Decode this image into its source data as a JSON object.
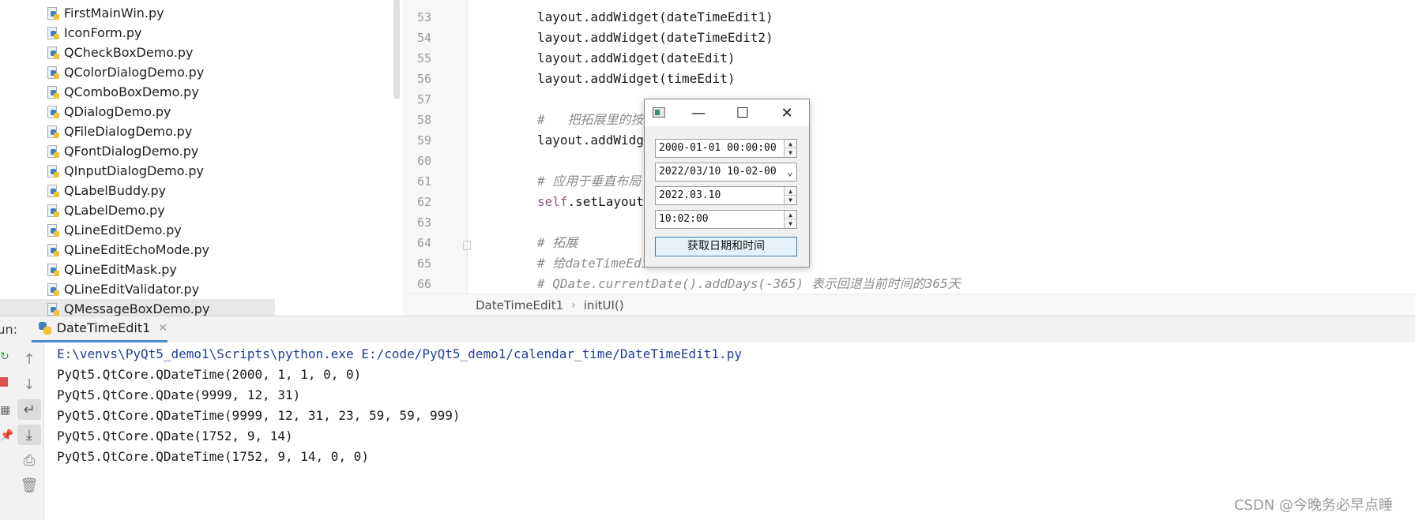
{
  "project_tree": {
    "items": [
      {
        "label": "FirstMainWin.py"
      },
      {
        "label": "IconForm.py"
      },
      {
        "label": "QCheckBoxDemo.py"
      },
      {
        "label": "QColorDialogDemo.py"
      },
      {
        "label": "QComboBoxDemo.py"
      },
      {
        "label": "QDialogDemo.py"
      },
      {
        "label": "QFileDialogDemo.py"
      },
      {
        "label": "QFontDialogDemo.py"
      },
      {
        "label": "QInputDialogDemo.py"
      },
      {
        "label": "QLabelBuddy.py"
      },
      {
        "label": "QLabelDemo.py"
      },
      {
        "label": "QLineEditDemo.py"
      },
      {
        "label": "QLineEditEchoMode.py"
      },
      {
        "label": "QLineEditMask.py"
      },
      {
        "label": "QLineEditValidator.py"
      },
      {
        "label": "QMessageBoxDemo.py"
      }
    ]
  },
  "editor": {
    "lines": [
      {
        "num": "53",
        "text": "layout.addWidget(dateTimeEdit1)"
      },
      {
        "num": "54",
        "text": "layout.addWidget(dateTimeEdit2)"
      },
      {
        "num": "55",
        "text": "layout.addWidget(dateEdit)"
      },
      {
        "num": "56",
        "text": "layout.addWidget(timeEdit)"
      },
      {
        "num": "57",
        "text": ""
      },
      {
        "num": "58",
        "text": "#   把拓展里的按"
      },
      {
        "num": "59",
        "text": "layout.addWidg"
      },
      {
        "num": "60",
        "text": ""
      },
      {
        "num": "61",
        "text": "# 应用于垂直布局"
      },
      {
        "num": "62",
        "text_kw": "self",
        "text_rest": ".setLayout"
      },
      {
        "num": "63",
        "text": ""
      },
      {
        "num": "64",
        "text": "# 拓展"
      },
      {
        "num": "65",
        "text": "# 给dateTimeEdit"
      },
      {
        "num": "66",
        "text": "# QDate.currentDate().addDays(-365) 表示回退当前时间的365天"
      }
    ],
    "breadcrumb": {
      "class_name": "DateTimeEdit1",
      "method": "initUI()"
    }
  },
  "run_panel": {
    "label": "Run:",
    "tab_label": "DateTimeEdit1",
    "output": [
      "E:\\venvs\\PyQt5_demo1\\Scripts\\python.exe E:/code/PyQt5_demo1/calendar_time/DateTimeEdit1.py",
      "PyQt5.QtCore.QDateTime(2000, 1, 1, 0, 0)",
      "PyQt5.QtCore.QDate(9999, 12, 31)",
      "PyQt5.QtCore.QDateTime(9999, 12, 31, 23, 59, 59, 999)",
      "PyQt5.QtCore.QDate(1752, 9, 14)",
      "PyQt5.QtCore.QDateTime(1752, 9, 14, 0, 0)"
    ]
  },
  "qt_window": {
    "minimize_glyph": "—",
    "maximize_glyph": "☐",
    "close_glyph": "✕",
    "datetime1": "2000-01-01 00:00:00",
    "datetime2": "2022/03/10 10-02-00",
    "date": "2022.03.10",
    "time": "10:02:00",
    "button_label": "获取日期和时间"
  },
  "watermark": "CSDN @今晚务必早点睡"
}
